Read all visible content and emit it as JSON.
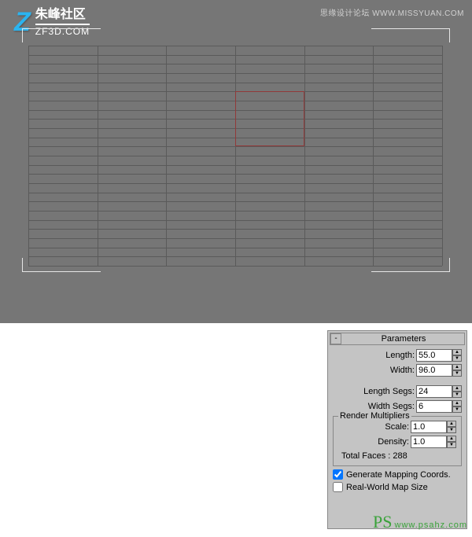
{
  "header": {
    "top_right": "思缘设计论坛 WWW.MISSYUAN.COM",
    "logo_cn": "朱峰社区",
    "logo_en": "ZF3D.COM"
  },
  "plane": {
    "length_segs": 24,
    "width_segs": 6
  },
  "panel": {
    "title": "Parameters",
    "collapse": "-",
    "length_label": "Length:",
    "length_value": "55.0",
    "width_label": "Width:",
    "width_value": "96.0",
    "lsegs_label": "Length Segs:",
    "lsegs_value": "24",
    "wsegs_label": "Width Segs:",
    "wsegs_value": "6",
    "render_mult_label": "Render Multipliers",
    "scale_label": "Scale:",
    "scale_value": "1.0",
    "density_label": "Density:",
    "density_value": "1.0",
    "total_faces": "Total Faces : 288",
    "gen_coords": "Generate Mapping Coords.",
    "real_world": "Real-World Map Size"
  },
  "watermark": {
    "ps": "PS",
    "url": "www.psahz.com"
  }
}
